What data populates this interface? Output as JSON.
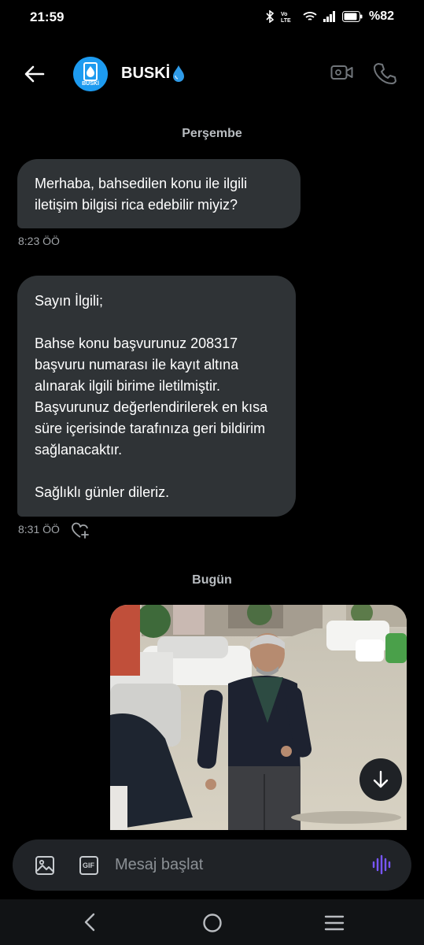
{
  "status_bar": {
    "time": "21:59",
    "battery": "%82",
    "icons": [
      "bluetooth-icon",
      "volte-icon",
      "wifi-icon",
      "signal-icon",
      "battery-icon"
    ]
  },
  "header": {
    "name": "BUSKİ",
    "avatar_label": "BUSKİ",
    "name_emoji": "water-drop-icon"
  },
  "conversation": {
    "separator_1": "Perşembe",
    "message_1": {
      "text": "Merhaba, bahsedilen konu ile ilgili iletişim bilgisi rica edebilir miyiz?",
      "time": "8:23 ÖÖ"
    },
    "message_2": {
      "text": "Sayın İlgili;\n\nBahse konu başvurunuz 208317 başvuru numarası ile kayıt altına alınarak ilgili birime iletilmiştir. Başvurunuz değerlendirilerek en kısa süre içerisinde tarafınıza geri bildirim sağlanacaktır.\n\nSağlıklı günler dileriz.",
      "time": "8:31 ÖÖ"
    },
    "separator_2": "Bugün"
  },
  "composer": {
    "placeholder": "Mesaj başlat",
    "gif_label": "GIF"
  },
  "colors": {
    "background": "#000000",
    "bubble": "#2f3336",
    "accent": "#1d9bf0",
    "voice_accent": "#7856ff"
  }
}
